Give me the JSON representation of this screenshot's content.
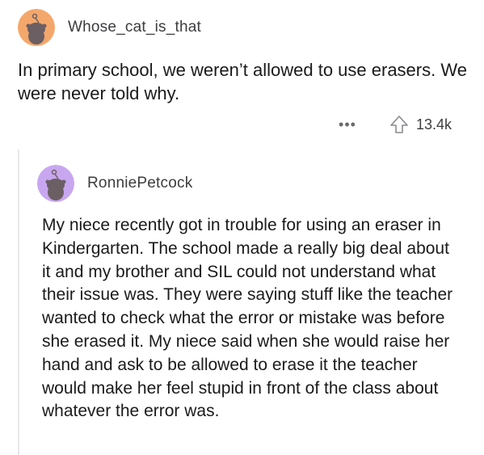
{
  "post": {
    "username": "Whose_cat_is_that",
    "avatar_color": "#f4a76b",
    "avatar_icon": "snoo-avatar-icon",
    "text": "In primary school, we weren’t allowed to use erasers. We were never told why.",
    "more_label": "•••",
    "upvote_icon": "upvote-arrow-icon",
    "vote_count": "13.4k"
  },
  "comment": {
    "username": "RonniePetcock",
    "avatar_color": "#c9a7f0",
    "avatar_icon": "snoo-avatar-icon",
    "text": "My niece recently got in trouble for using an eraser in Kindergarten. The school made a really big deal about it and my brother and SIL could not understand what their issue was. They were saying stuff like the teacher wanted to check what the error or mistake was before she erased it. My niece said when she would raise her hand and ask to be allowed to erase it the teacher would make her feel stupid in front of the class about whatever the error was."
  }
}
